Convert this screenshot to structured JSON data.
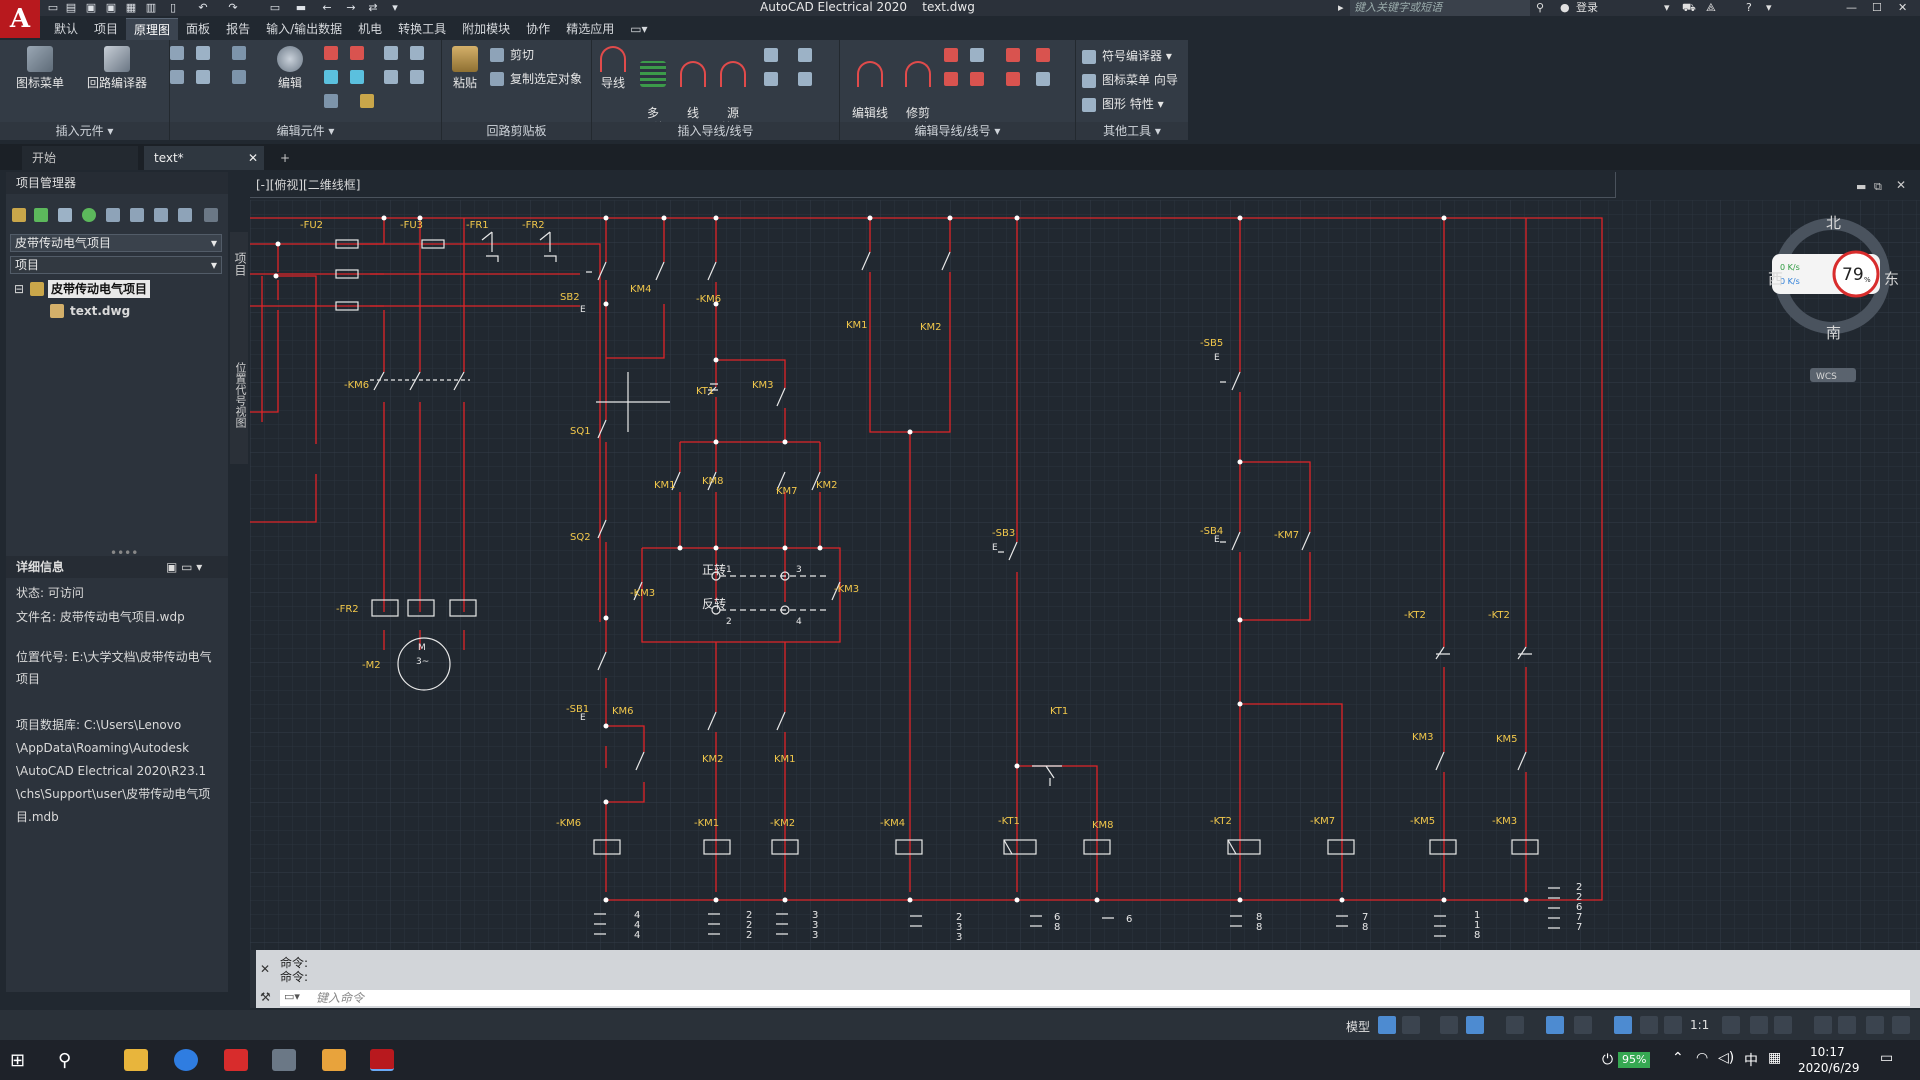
{
  "window": {
    "app_title": "AutoCAD Electrical 2020",
    "file_title": "text.dwg",
    "search_placeholder": "键入关键字或短语",
    "login": "登录",
    "logo": "A"
  },
  "ribbon_tabs": [
    "默认",
    "项目",
    "原理图",
    "面板",
    "报告",
    "输入/输出数据",
    "机电",
    "转换工具",
    "附加模块",
    "协作",
    "精选应用"
  ],
  "ribbon": {
    "insert_components": {
      "title": "插入元件",
      "btn1": "图标菜单",
      "btn2": "回路编译器"
    },
    "edit_components": {
      "title": "编辑元件",
      "btn1": "编辑"
    },
    "circuit_clipboard": {
      "title": "回路剪贴板",
      "paste": "粘贴",
      "cut": "剪切",
      "copy": "复制选定对象"
    },
    "insert_wires": {
      "title": "插入导线/线号",
      "wire": "导线",
      "multi_bus": "多\n母线",
      "wire_no": "线\n号",
      "source_arrow": "源\n箭头"
    },
    "edit_wires": {
      "title": "编辑导线/线号",
      "edit_wire_no": "编辑线\n号",
      "trim_wire": "修剪\n导线"
    },
    "other_tools": {
      "title": "其他工具",
      "symbol_builder": "符号编译器",
      "icon_menu_wizard": "图标菜单 向导",
      "shape_props": "图形 特性"
    }
  },
  "doc_tabs": {
    "start": "开始",
    "file": "text*",
    "plus": "+"
  },
  "project_manager": {
    "title": "项目管理器",
    "project_select": "皮带传动电气项目",
    "project_label": "项目",
    "tree_project": "皮带传动电气项目",
    "tree_file": "text.dwg",
    "side_tab1": "项目",
    "side_tab2": "位置代号视图",
    "details_title": "详细信息",
    "details": [
      "状态: 可访问",
      "文件名: 皮带传动电气项目.wdp",
      "位置代号: E:\\大学文档\\皮带传动电气",
      "项目",
      "项目数据库: C:\\Users\\Lenovo",
      "\\AppData\\Roaming\\Autodesk",
      "\\AutoCAD Electrical 2020\\R23.1",
      "\\chs\\Support\\user\\皮带传动电气项",
      "目.mdb"
    ]
  },
  "viewport": {
    "label": "[-][俯视][二维线框]"
  },
  "viewcube": {
    "north": "北",
    "south": "南",
    "east": "东",
    "west": "西",
    "wcs": "WCS",
    "speed_up": "0  K/s",
    "speed_down": "0  K/s",
    "percent": "79",
    "percent_unit": "%"
  },
  "schematic": {
    "labels": {
      "fu2": "-FU2",
      "fu3": "-FU3",
      "fr1": "-FR1",
      "fr2_top": "-FR2",
      "km6_main": "-KM6",
      "fr2": "-FR2",
      "m2": "-M2",
      "motor": "M",
      "motor3": "3~",
      "sb2": "SB2",
      "km4": "KM4",
      "km6_a": "-KM6",
      "km1_top": "KM1",
      "km2_top": "KM2",
      "kt1_a": "KT1",
      "km3_a": "KM3",
      "sq1": "SQ1",
      "km1_b": "KM1",
      "km8_b": "KM8",
      "km7_b": "KM7",
      "km2_b": "KM2",
      "sq2": "SQ2",
      "km3_l": "-KM3",
      "km3_r": "-KM3",
      "forward": "正转",
      "reverse": "反转",
      "p1": "1",
      "p2": "2",
      "p3": "3",
      "p4": "4",
      "sb1": "-SB1",
      "km6_c": "KM6",
      "km2_c": "KM2",
      "km1_c": "KM1",
      "sb3": "-SB3",
      "sb5": "-SB5",
      "sb4": "-SB4",
      "km7_d": "-KM7",
      "kt1_d": "KT1",
      "kt2_a": "-KT2",
      "kt2_b": "-KT2",
      "km3_d": "KM3",
      "km5_d": "KM5",
      "coil_km6": "-KM6",
      "coil_km1": "-KM1",
      "coil_km2": "-KM2",
      "coil_km4": "-KM4",
      "coil_kt1": "-KT1",
      "coil_km8": "KM8",
      "coil_kt2": "-KT2",
      "coil_km7": "-KM7",
      "coil_km5": "-KM5",
      "coil_km3": "-KM3",
      "e": "E"
    },
    "xref": [
      [
        "4",
        "4",
        "4"
      ],
      [
        "2",
        "2",
        "2"
      ],
      [
        "3",
        "3",
        "3"
      ],
      [
        "2",
        "3",
        "3"
      ],
      [
        "6",
        "8"
      ],
      [
        "6"
      ],
      [
        "8",
        "8"
      ],
      [
        "7",
        "8"
      ],
      [
        "1",
        "1",
        "8"
      ],
      [
        "2",
        "2",
        "6",
        "7",
        "7"
      ]
    ]
  },
  "command": {
    "line1": "命令:",
    "line2": "命令:",
    "input_placeholder": "键入命令"
  },
  "statusbar": {
    "model": "模型",
    "scale": "1:1"
  },
  "taskbar": {
    "battery": "95%",
    "ime": "中",
    "time": "10:17",
    "date": "2020/6/29"
  }
}
